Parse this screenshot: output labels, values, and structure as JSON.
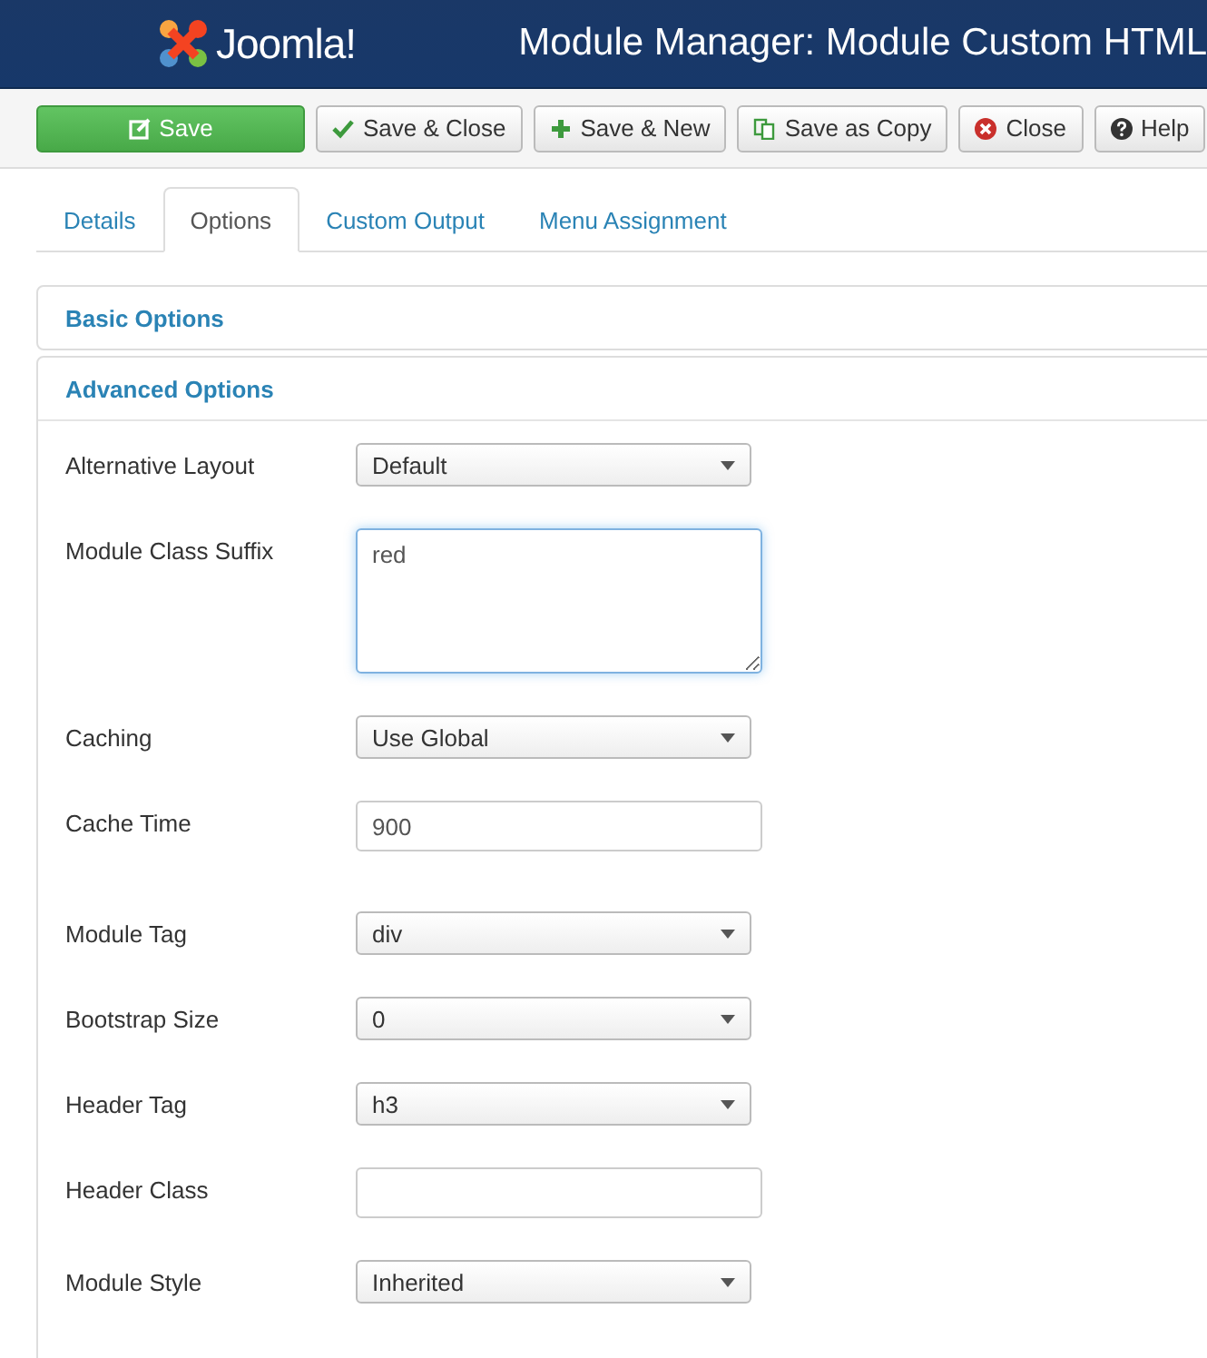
{
  "header": {
    "logo_text": "Joomla!",
    "title": "Module Manager: Module Custom HTML"
  },
  "toolbar": [
    {
      "label": "Save",
      "kind": "primary"
    },
    {
      "label": "Save & Close",
      "kind": "default"
    },
    {
      "label": "Save & New",
      "kind": "default"
    },
    {
      "label": "Save as Copy",
      "kind": "default"
    },
    {
      "label": "Close",
      "kind": "default"
    },
    {
      "label": "Help",
      "kind": "default"
    }
  ],
  "tabs": [
    {
      "label": "Details",
      "selected": false
    },
    {
      "label": "Options",
      "selected": true
    },
    {
      "label": "Custom Output",
      "selected": false
    },
    {
      "label": "Menu Assignment",
      "selected": false
    }
  ],
  "panels": [
    {
      "title": "Basic Options",
      "expanded": false
    },
    {
      "title": "Advanced Options",
      "expanded": true
    }
  ],
  "fields": [
    {
      "label": "Alternative Layout",
      "kind": "select",
      "value": "Default"
    },
    {
      "label": "Module Class Suffix",
      "kind": "textarea",
      "value": "red"
    },
    {
      "label": "Caching",
      "kind": "select",
      "value": "Use Global"
    },
    {
      "label": "Cache Time",
      "kind": "text",
      "value": "900"
    },
    {
      "label": "Module Tag",
      "kind": "select",
      "value": "div"
    },
    {
      "label": "Bootstrap Size",
      "kind": "select",
      "value": "0"
    },
    {
      "label": "Header Tag",
      "kind": "select",
      "value": "h3"
    },
    {
      "label": "Header Class",
      "kind": "text"
    },
    {
      "label": "Module Style",
      "kind": "select",
      "value": "Inherited"
    }
  ]
}
